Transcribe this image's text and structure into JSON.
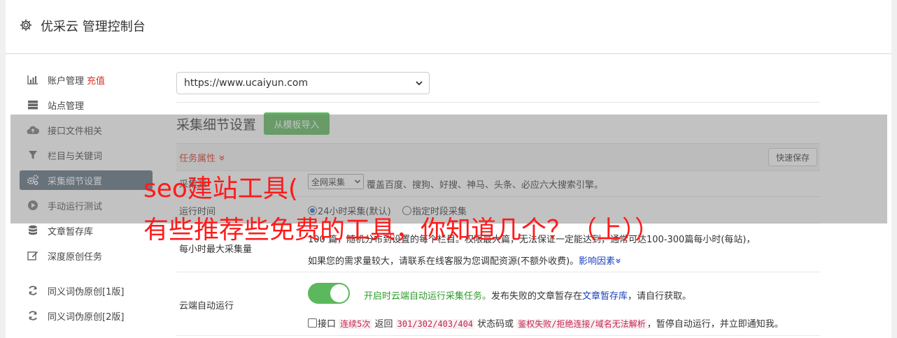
{
  "header": {
    "title": "优采云 管理控制台"
  },
  "sidebar": {
    "items": [
      {
        "label": "账户管理",
        "extra": "充值",
        "icon": "bar-chart-icon"
      },
      {
        "label": "站点管理",
        "icon": "server-icon"
      },
      {
        "label": "接口文件相关",
        "icon": "cloud-upload-icon"
      },
      {
        "label": "栏目与关键词",
        "icon": "filter-icon"
      },
      {
        "label": "采集细节设置",
        "icon": "cogs-icon",
        "active": true
      },
      {
        "label": "手动运行测试",
        "icon": "play-circle-icon"
      },
      {
        "label": "文章暂存库",
        "icon": "database-icon"
      },
      {
        "label": "深度原创任务",
        "icon": "edit-icon"
      },
      {
        "label": "同义词伪原创[1版]",
        "icon": "refresh-icon"
      },
      {
        "label": "同义词伪原创[2版]",
        "icon": "refresh-icon"
      }
    ]
  },
  "main": {
    "site_select": "https://www.ucaiyun.com",
    "section_title": "采集细节设置",
    "template_button": "从模板导入",
    "task_label": "任务属性 ",
    "save_button": "快速保存",
    "rows": {
      "source_label": "采集源",
      "source_select": "全网采集",
      "source_desc": "覆盖百度、搜狗、好搜、神马、头条、必应六大搜索引擎。",
      "runtime_label": "运行时间",
      "runtime_opt1": "24小时采集(默认)",
      "runtime_opt2": "指定时段采集",
      "max_label": "每小时最大采集量",
      "max_line1_a": "100",
      "max_line1_b": "篇",
      "max_line1_c": "随机分布到设置的每个栏目。权限最大篇，无法保证一定能达到",
      "max_line1_d": "，通常可达100-300篇每小时(每站)，",
      "max_line2": "如果您的需求量较大，请联系在线客服为您调配资源(不额外收费)。",
      "max_link": "影响因素",
      "cloud_label": "云端自动运行",
      "cloud_desc_green": "开启时云端自动运行采集任务。",
      "cloud_desc_mid": "发布失败的文章暂存在",
      "cloud_link": "文章暂存库",
      "cloud_desc_end": "，请自行获取。",
      "iface_label": "接口",
      "iface_code1": "连续5次",
      "iface_txt1": " 返回 ",
      "iface_code2": "301/302/403/404",
      "iface_txt2": " 状态码或 ",
      "iface_code3": "鉴权失败/拒绝连接/域名无法解析",
      "iface_txt3": "，暂停自动运行，并立即通知我。"
    }
  },
  "overlay": {
    "line1": "seo建站工具(",
    "line2": "有些推荐些免费的工具，你知道几个？（上））"
  },
  "colors": {
    "accent_red": "#d9301a",
    "green": "#5cb85c",
    "link": "#1a3fb8",
    "sidebar_active": "#5a6d7f"
  }
}
